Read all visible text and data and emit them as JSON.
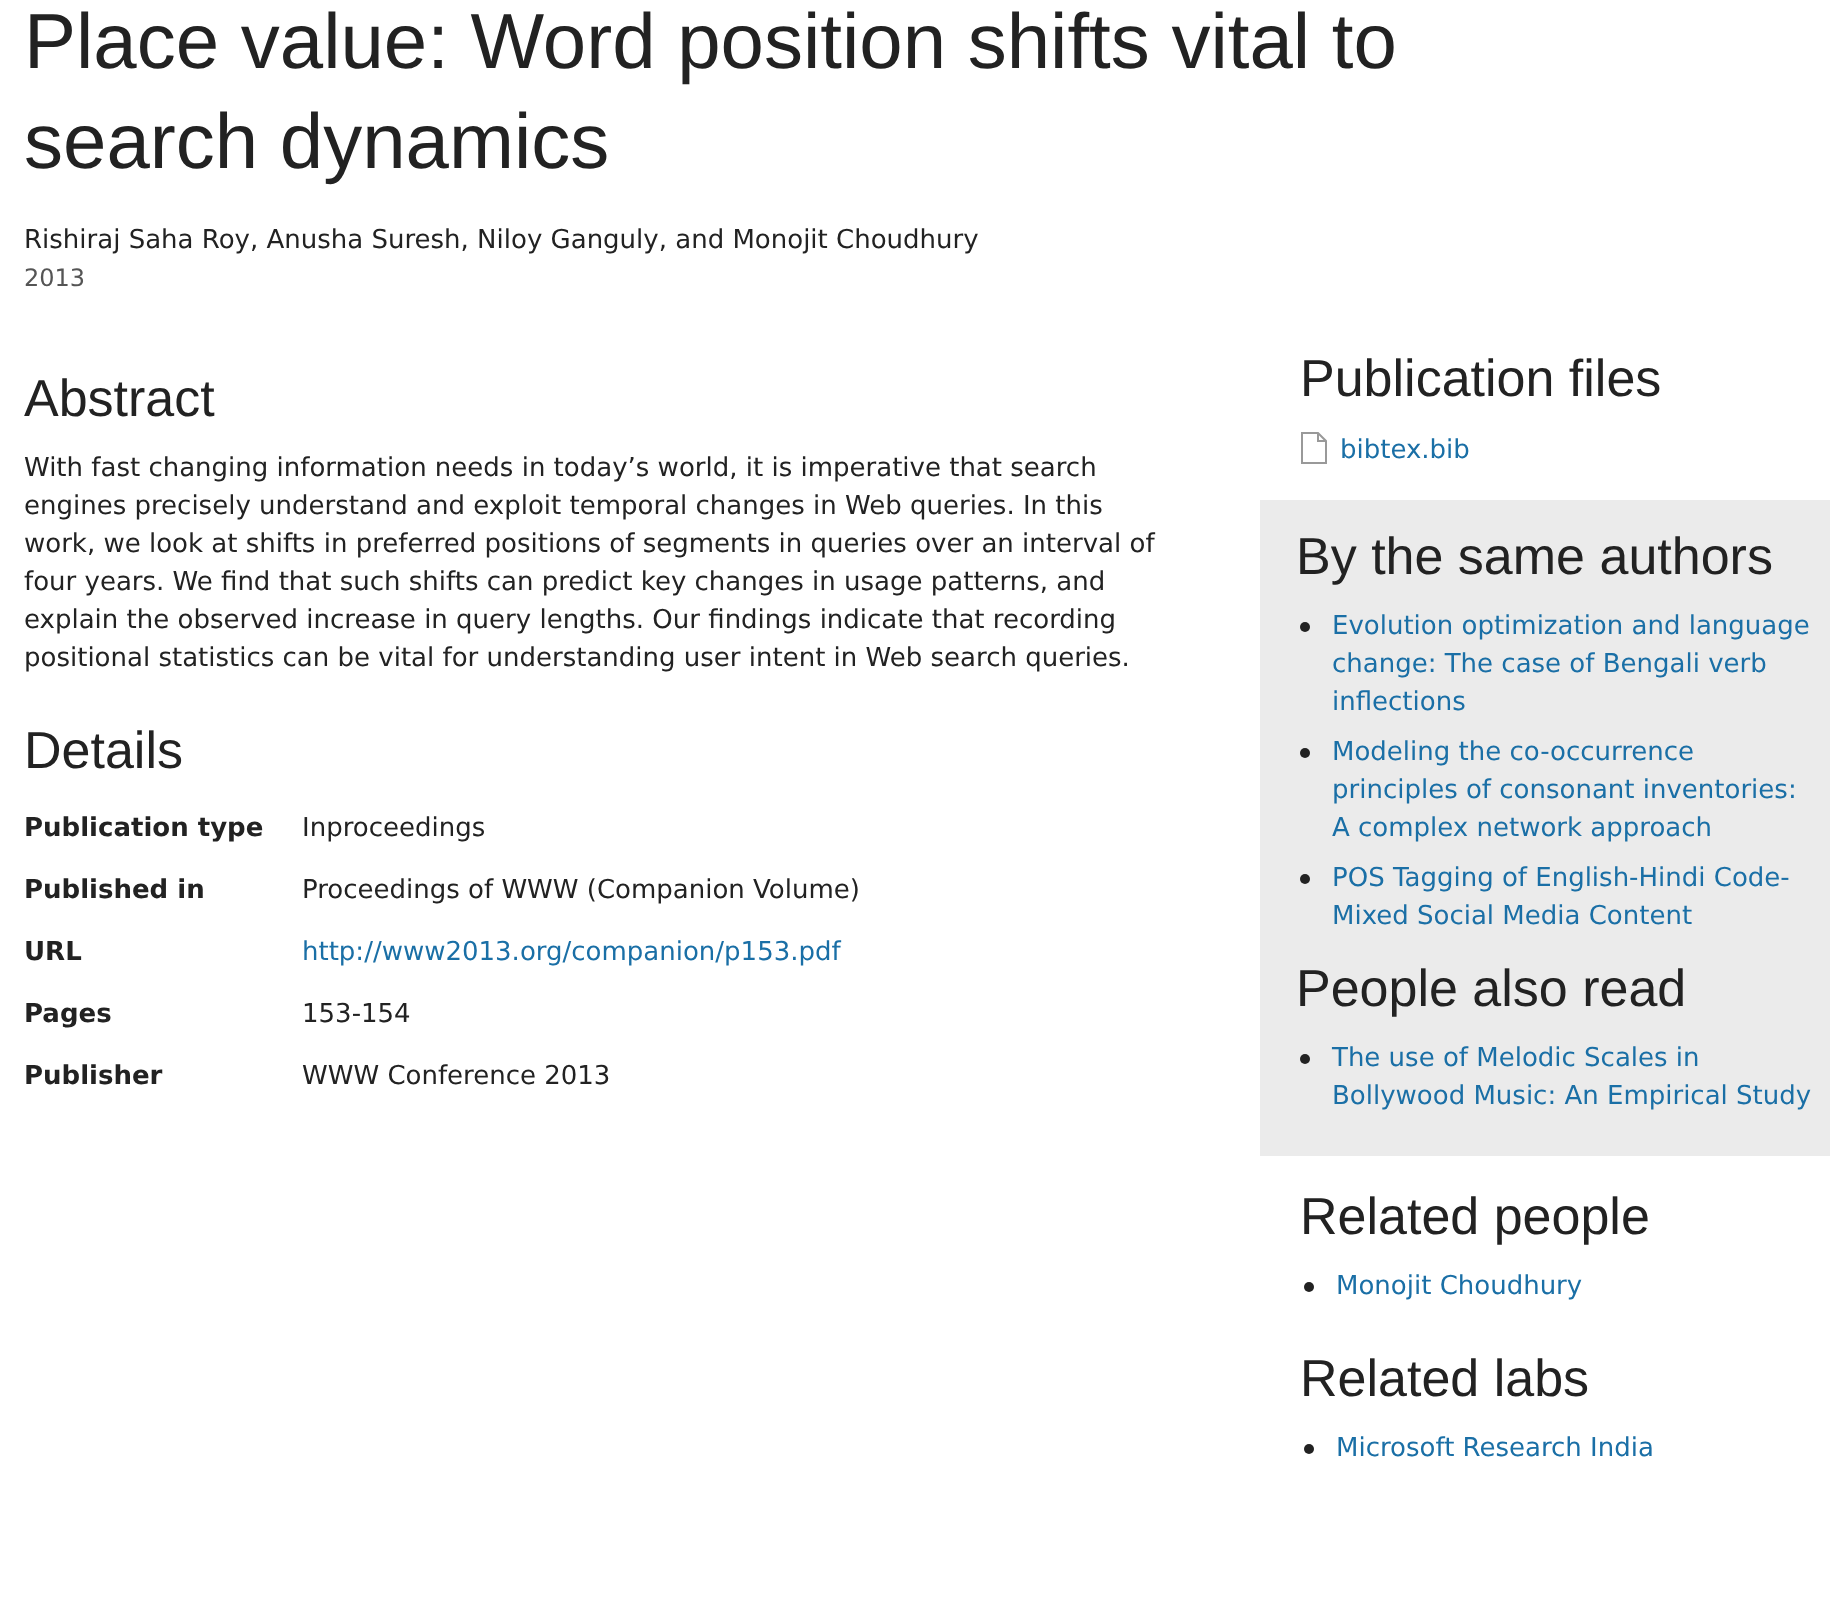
{
  "title": "Place value: Word position shifts vital to search dynamics",
  "authors": "Rishiraj Saha Roy, Anusha Suresh, Niloy Ganguly, and Monojit Choudhury",
  "year": "2013",
  "abstract": {
    "heading": "Abstract",
    "text": "With fast changing information needs in today’s world, it is imperative that search engines precisely understand and exploit temporal changes in Web queries. In this work, we look at shifts in preferred positions of segments in queries over an interval of four years. We find that such shifts can predict key changes in usage patterns, and explain the observed increase in query lengths. Our findings indicate that recording positional statistics can be vital for understanding user intent in Web search queries."
  },
  "details": {
    "heading": "Details",
    "rows": [
      {
        "label": "Publication type",
        "value": "Inproceedings",
        "kind": "text"
      },
      {
        "label": "Published in",
        "value": "Proceedings of WWW (Companion Volume)",
        "kind": "text"
      },
      {
        "label": "URL",
        "value": "http://www2013.org/companion/p153.pdf",
        "kind": "link"
      },
      {
        "label": "Pages",
        "value": "153-154",
        "kind": "text"
      },
      {
        "label": "Publisher",
        "value": "WWW Conference 2013",
        "kind": "text"
      }
    ]
  },
  "sidebar": {
    "publication_files": {
      "heading": "Publication files",
      "files": [
        "bibtex.bib"
      ]
    },
    "shaded_sections": [
      {
        "heading": "By the same authors",
        "items": [
          "Evolution optimization and language change: The case of Bengali verb inflections",
          "Modeling the co-occurrence principles of consonant inventories: A complex network approach",
          "POS Tagging of English-Hindi Code-Mixed Social Media Content"
        ]
      },
      {
        "heading": "People also read",
        "items": [
          "The use of Melodic Scales in Bollywood Music: An Empirical Study"
        ]
      }
    ],
    "plain_sections": [
      {
        "heading": "Related people",
        "items": [
          "Monojit Choudhury"
        ]
      },
      {
        "heading": "Related labs",
        "items": [
          "Microsoft Research India"
        ]
      }
    ]
  }
}
